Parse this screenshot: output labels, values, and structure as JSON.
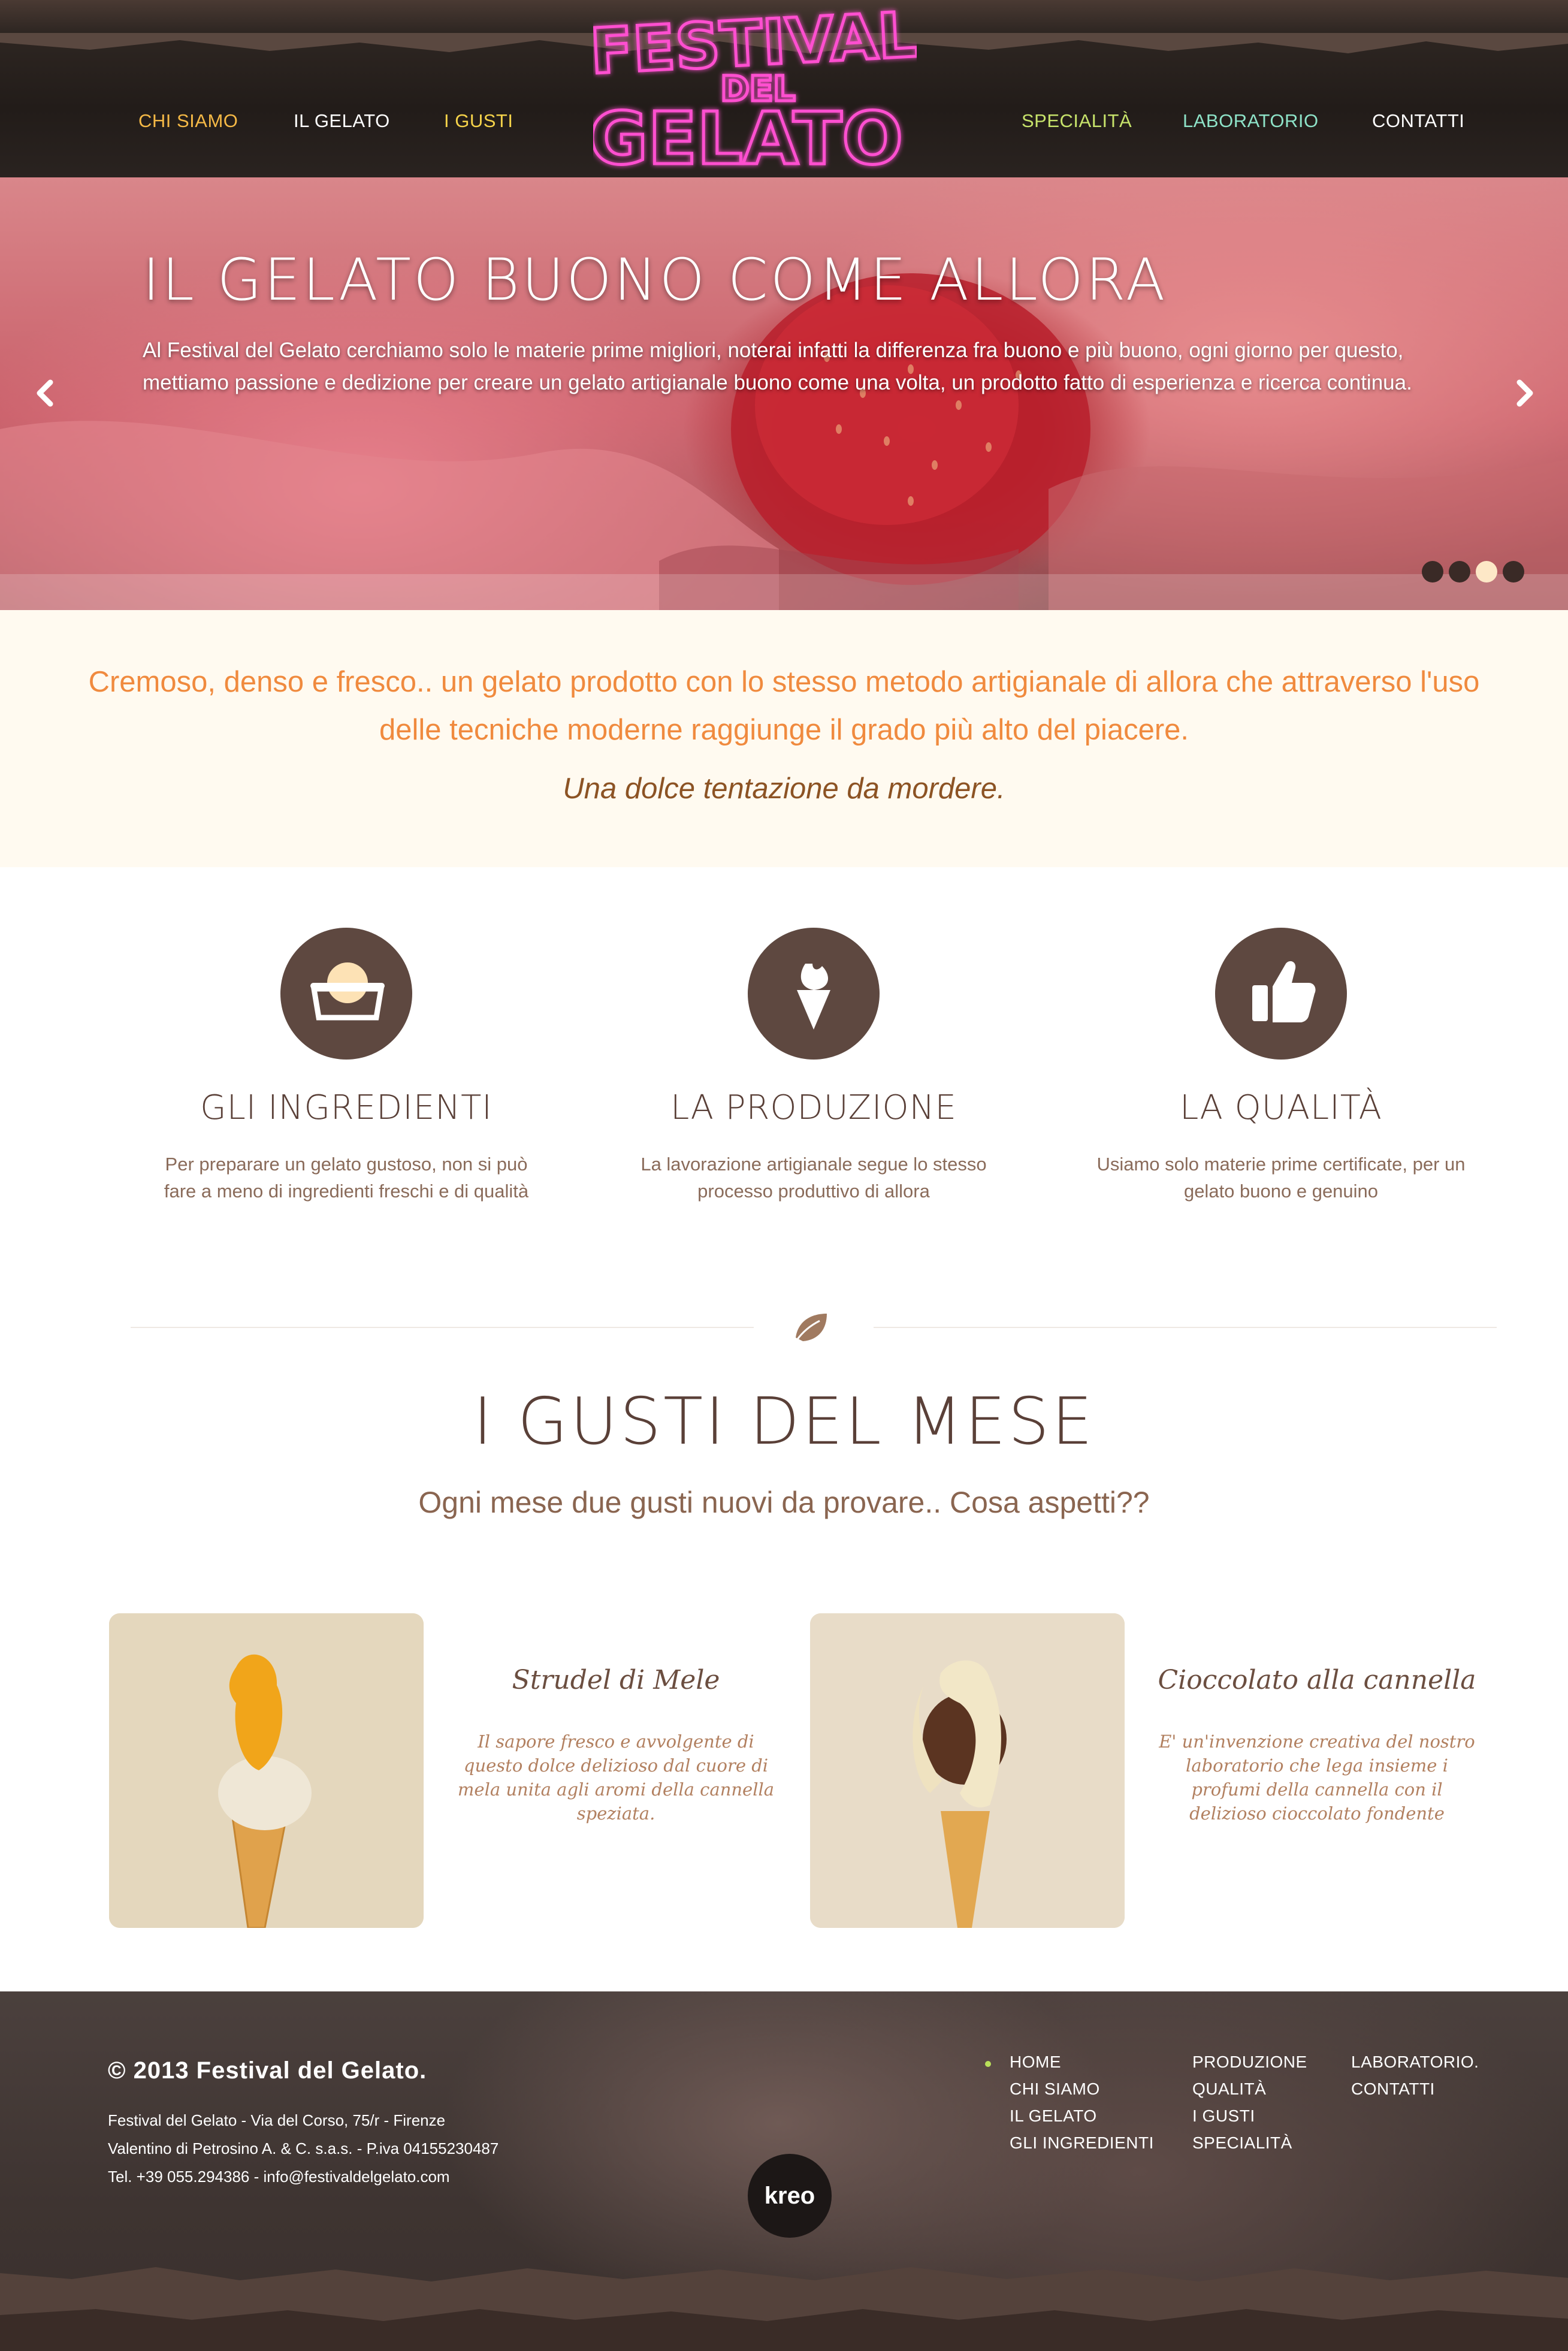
{
  "header": {
    "logo": {
      "line1": "FESTIVAL",
      "line2": "DEL",
      "line3": "GELATO"
    },
    "nav_left": [
      {
        "label": "CHI SIAMO",
        "color": "#f5b946"
      },
      {
        "label": "IL GELATO",
        "color": "#ffffff"
      },
      {
        "label": "I GUSTI",
        "color": "#f5d34a"
      }
    ],
    "nav_right": [
      {
        "label": "SPECIALITÀ",
        "color": "#c7e36b"
      },
      {
        "label": "LABORATORIO",
        "color": "#8ee3c8"
      },
      {
        "label": "CONTATTI",
        "color": "#ffffff"
      }
    ]
  },
  "hero": {
    "title": "IL GELATO BUONO COME ALLORA",
    "text": "Al Festival del Gelato cerchiamo solo le materie prime migliori, noterai infatti la differenza fra buono e più buono, ogni giorno per questo, mettiamo passione e dedizione per creare un gelato artigianale buono come una volta, un prodotto fatto di esperienza e ricerca continua.",
    "prev_icon": "chevron-left-icon",
    "next_icon": "chevron-right-icon",
    "slides_total": 4,
    "active_slide": 3
  },
  "intro": {
    "text": "Cremoso, denso e fresco.. un gelato prodotto con lo stesso metodo artigianale di allora che attraverso l'uso delle tecniche moderne raggiunge il grado più alto del piacere.",
    "tagline": "Una dolce tentazione da mordere."
  },
  "features": [
    {
      "icon": "gelato-tub-icon",
      "title": "GLI INGREDIENTI",
      "text": "Per preparare un gelato gustoso, non si può fare a meno di ingredienti freschi e di qualità"
    },
    {
      "icon": "ice-cream-cone-icon",
      "title": "LA PRODUZIONE",
      "text": "La lavorazione artigianale segue lo stesso processo produttivo di allora"
    },
    {
      "icon": "thumbs-up-icon",
      "title": "LA QUALITÀ",
      "text": "Usiamo solo materie prime certificate, per un gelato buono e genuino"
    }
  ],
  "gusti": {
    "title": "I GUSTI DEL MESE",
    "subtitle": "Ogni mese due gusti nuovi da provare.. Cosa aspetti??",
    "items": [
      {
        "name": "Strudel di Mele",
        "text": "Il sapore fresco e avvolgente di questo dolce delizioso dal cuore di mela unita agli aromi della cannella speziata."
      },
      {
        "name": "Cioccolato alla cannella",
        "text": "E' un'invenzione creativa del nostro laboratorio che lega insieme i profumi della cannella con il delizioso cioccolato fondente"
      }
    ]
  },
  "footer": {
    "copyright": "© 2013 Festival del Gelato.",
    "address_lines": [
      "Festival del Gelato - Via del Corso, 75/r - Firenze",
      "Valentino di Petrosino A. & C. s.a.s. - P.iva 04155230487",
      "Tel. +39 055.294386 - info@festivaldelgelato.com"
    ],
    "links_col1": [
      "HOME",
      "CHI SIAMO",
      "IL GELATO",
      "GLI INGREDIENTI"
    ],
    "links_col2": [
      "PRODUZIONE",
      "QUALITÀ",
      "I GUSTI",
      "SPECIALITÀ"
    ],
    "links_col3": [
      "LABORATORIO.",
      "CONTATTI"
    ],
    "badge": "kreo"
  }
}
